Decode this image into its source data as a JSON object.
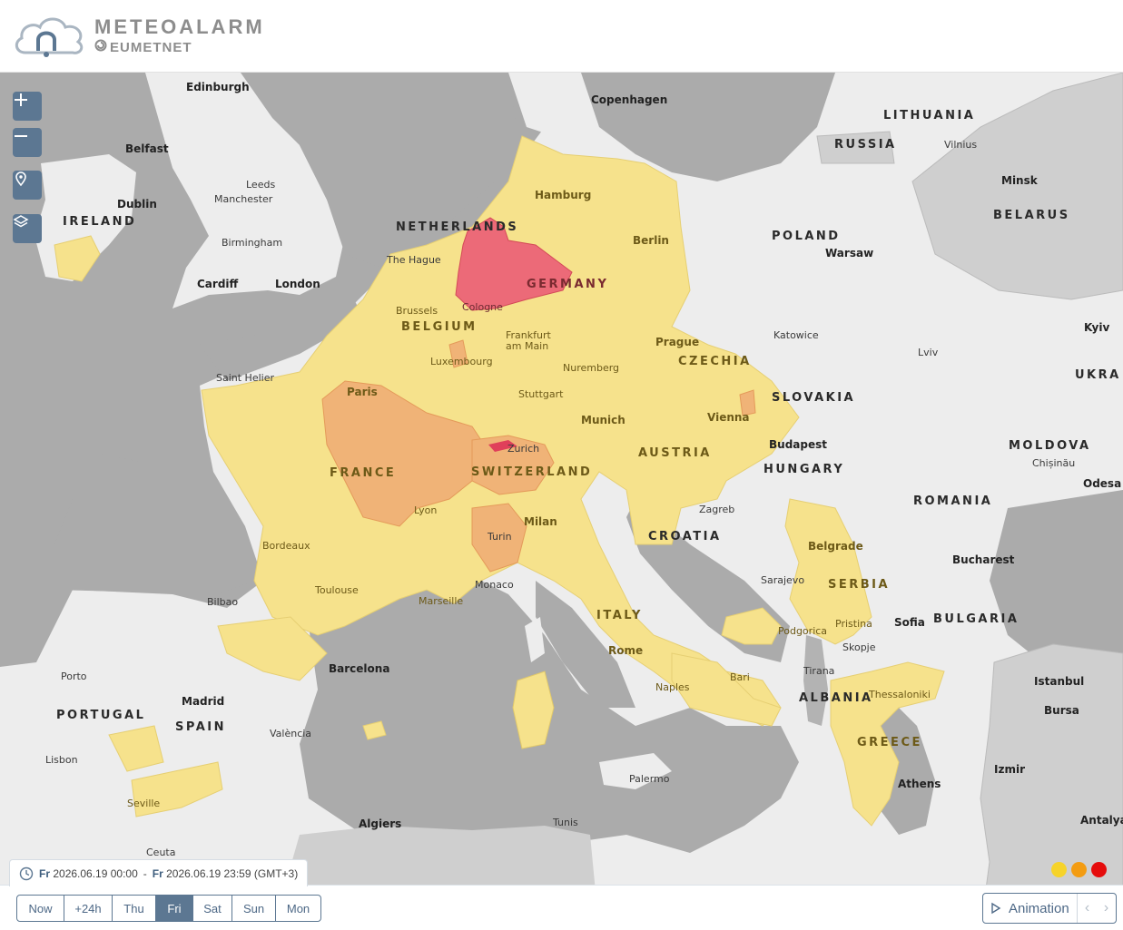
{
  "header": {
    "title": "METEOALARM",
    "subtitle": "EUMETNET",
    "logo_icon": "cloud-bell-logo"
  },
  "map_controls": {
    "zoom_in_icon": "plus-icon",
    "zoom_out_icon": "minus-icon",
    "locate_icon": "location-pin-icon",
    "layers_icon": "layers-icon"
  },
  "countries": [
    "LITHUANIA",
    "RUSSIA",
    "BELARUS",
    "IRELAND",
    "NETHERLANDS",
    "GERMANY",
    "POLAND",
    "BELGIUM",
    "CZECHIA",
    "SLOVAKIA",
    "UKRA",
    "MOLDOVA",
    "AUSTRIA",
    "HUNGARY",
    "FRANCE",
    "SWITZERLAND",
    "ROMANIA",
    "CROATIA",
    "SERBIA",
    "ITALY",
    "BULGARIA",
    "PORTUGAL",
    "SPAIN",
    "ALBANIA",
    "GREECE"
  ],
  "cities": [
    "Edinburgh",
    "Copenhagen",
    "Vilnius",
    "Belfast",
    "Leeds",
    "Manchester",
    "Hamburg",
    "Minsk",
    "Dublin",
    "Birmingham",
    "Berlin",
    "Warsaw",
    "The Hague",
    "Cardiff",
    "London",
    "Brussels",
    "Cologne",
    "Kyiv",
    "Frankfurt am Main",
    "Prague",
    "Katowice",
    "Lviv",
    "Luxembourg",
    "Nuremberg",
    "Saint Helier",
    "Paris",
    "Stuttgart",
    "Munich",
    "Vienna",
    "Budapest",
    "Zurich",
    "Chișinău",
    "Odesa",
    "Zagreb",
    "Lyon",
    "Milan",
    "Turin",
    "Bordeaux",
    "Belgrade",
    "Bucharest",
    "Sarajevo",
    "Monaco",
    "Toulouse",
    "Marseille",
    "Bilbao",
    "Podgorica",
    "Pristina",
    "Sofia",
    "Skopje",
    "Rome",
    "Tirana",
    "Barcelona",
    "Bari",
    "Istanbul",
    "Porto",
    "Naples",
    "Thessaloniki",
    "Madrid",
    "Bursa",
    "València",
    "Lisbon",
    "Izmir",
    "Palermo",
    "Athens",
    "Seville",
    "Algiers",
    "Tunis",
    "Antalya",
    "Ceuta"
  ],
  "time_range": {
    "clock_icon": "clock-icon",
    "start_day": "Fr",
    "start": "2026.06.19 00:00",
    "separator": "-",
    "end_day": "Fr",
    "end": "2026.06.19 23:59 (GMT+3)"
  },
  "day_tabs": [
    "Now",
    "+24h",
    "Thu",
    "Fri",
    "Sat",
    "Sun",
    "Mon"
  ],
  "selected_tab": "Fri",
  "animation": {
    "label": "Animation",
    "play_icon": "play-icon",
    "prev_icon": "chevron-left-icon",
    "next_icon": "chevron-right-icon"
  },
  "warning_levels": [
    {
      "level": "yellow",
      "color": "#f6d32a"
    },
    {
      "level": "orange",
      "color": "#f39c12"
    },
    {
      "level": "red",
      "color": "#e50c0c"
    }
  ],
  "colors": {
    "accent": "#5c7792",
    "sea": "#ababab",
    "land": "#ededed",
    "non_member": "#cfcfcf",
    "yellow_warning": "#f6e28c",
    "orange_warning": "#f0b377",
    "red_warning": "#ec6a78"
  }
}
